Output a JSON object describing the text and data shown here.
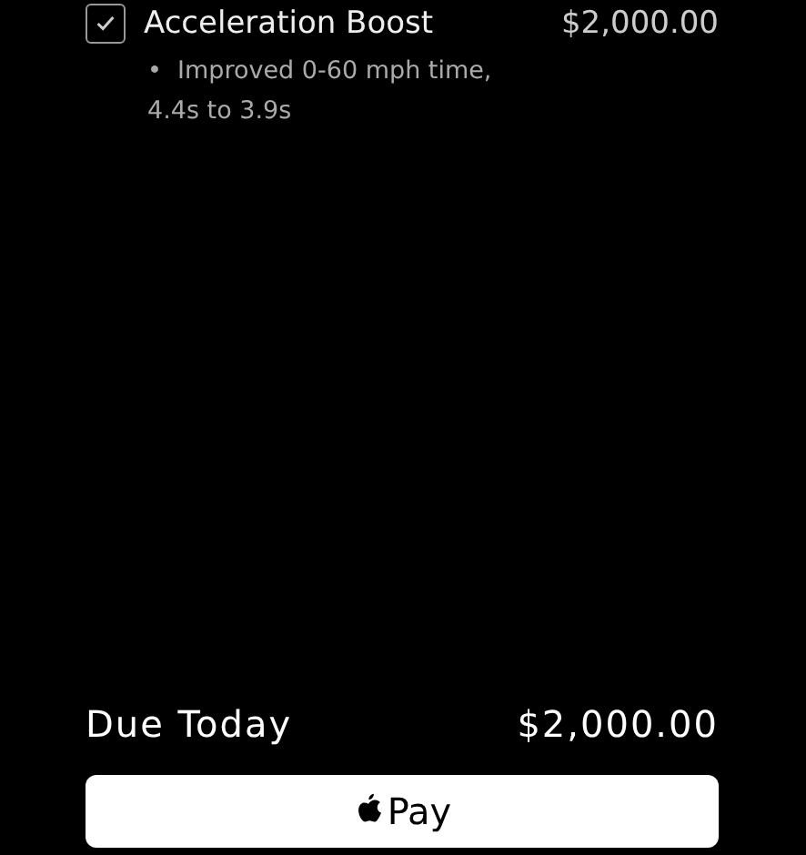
{
  "option": {
    "checked": true,
    "name": "Acceleration Boost",
    "price": "$2,000.00",
    "details": [
      "•  Improved 0-60 mph time, 4.4s to 3.9s"
    ]
  },
  "due": {
    "label": "Due Today",
    "amount": "$2,000.00"
  },
  "pay_button": {
    "label": "Pay"
  }
}
